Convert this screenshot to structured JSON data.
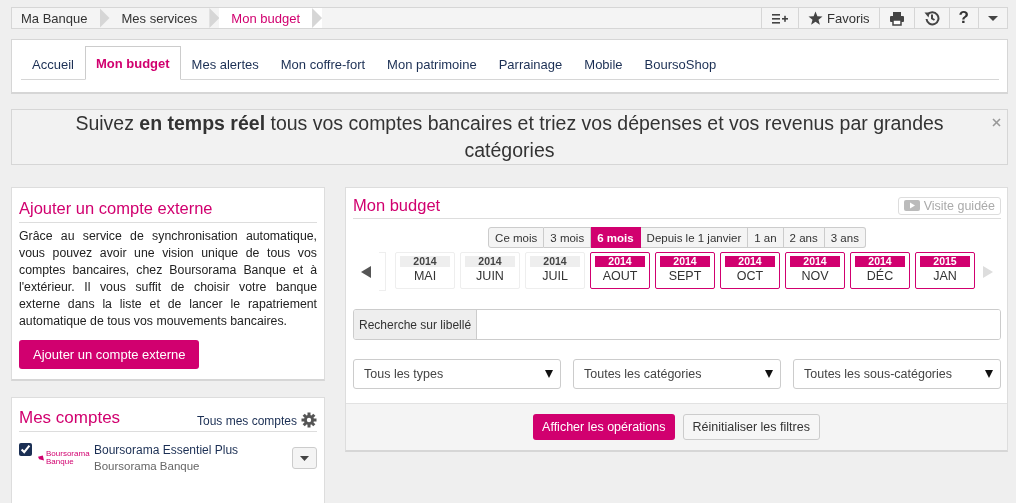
{
  "breadcrumb": {
    "items": [
      {
        "label": "Ma Banque",
        "selected": false
      },
      {
        "label": "Mes services",
        "selected": false
      },
      {
        "label": "Mon budget",
        "selected": true
      }
    ],
    "favorites_label": "Favoris",
    "help_label": "?"
  },
  "tabs": [
    {
      "label": "Accueil",
      "selected": false
    },
    {
      "label": "Mon budget",
      "selected": true
    },
    {
      "label": "Mes alertes",
      "selected": false
    },
    {
      "label": "Mon coffre-fort",
      "selected": false
    },
    {
      "label": "Mon patrimoine",
      "selected": false
    },
    {
      "label": "Parrainage",
      "selected": false
    },
    {
      "label": "Mobile",
      "selected": false
    },
    {
      "label": "BoursoShop",
      "selected": false
    }
  ],
  "banner": {
    "text": "Suivez **en temps réel** tous vos comptes bancaires et triez vos dépenses et vos revenus par grandes catégories"
  },
  "external_account": {
    "title": "Ajouter un compte externe",
    "text": "Grâce au service de synchronisation automatique, vous pouvez avoir une vision unique de tous vos comptes bancaires, chez Boursorama Banque et à l'extérieur. Il vous suffit de choisir votre banque externe dans la liste et de lancer le rapatriement automatique de tous vos mouvements bancaires.",
    "button": "Ajouter un compte externe"
  },
  "accounts": {
    "title": "Mes comptes",
    "all_link": "Tous mes comptes",
    "items": [
      {
        "name": "Boursorama Essentiel Plus",
        "bank": "Boursorama Banque",
        "logo_text": "Boursorama Banque",
        "checked": true
      }
    ]
  },
  "budget": {
    "title": "Mon budget",
    "guided_tour": "Visite guidée",
    "periods": [
      {
        "label": "Ce mois",
        "selected": false
      },
      {
        "label": "3 mois",
        "selected": false
      },
      {
        "label": "6 mois",
        "selected": true
      },
      {
        "label": "Depuis le 1 janvier",
        "selected": false
      },
      {
        "label": "1 an",
        "selected": false
      },
      {
        "label": "2 ans",
        "selected": false
      },
      {
        "label": "3 ans",
        "selected": false
      }
    ],
    "months": [
      {
        "year": "2014",
        "month": "MAI",
        "selected": false
      },
      {
        "year": "2014",
        "month": "JUIN",
        "selected": false
      },
      {
        "year": "2014",
        "month": "JUIL",
        "selected": false
      },
      {
        "year": "2014",
        "month": "AOUT",
        "selected": true
      },
      {
        "year": "2014",
        "month": "SEPT",
        "selected": true
      },
      {
        "year": "2014",
        "month": "OCT",
        "selected": true
      },
      {
        "year": "2014",
        "month": "NOV",
        "selected": true
      },
      {
        "year": "2014",
        "month": "DÉC",
        "selected": true
      },
      {
        "year": "2015",
        "month": "JAN",
        "selected": true
      }
    ],
    "search_label": "Recherche sur libellé",
    "filters": [
      "Tous les types",
      "Toutes les catégories",
      "Toutes les sous-catégories"
    ],
    "show_button": "Afficher les opérations",
    "reset_button": "Réinitialiser les filtres"
  }
}
